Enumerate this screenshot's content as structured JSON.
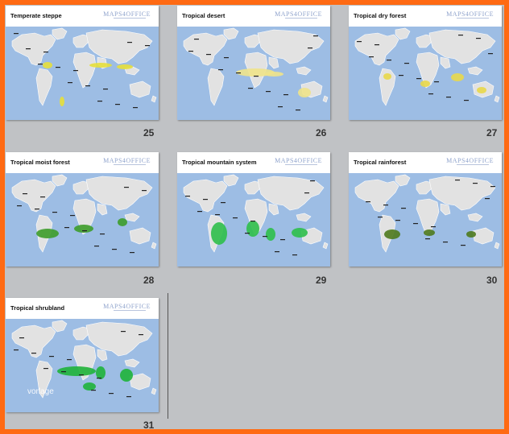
{
  "slides": [
    {
      "title": "Temperate steppe",
      "number": "25",
      "logo": "MAPS4OFFICE",
      "highlight": "#e7df3a"
    },
    {
      "title": "Tropical desert",
      "number": "26",
      "logo": "MAPS4OFFICE",
      "highlight": "#f0e38a"
    },
    {
      "title": "Tropical dry forest",
      "number": "27",
      "logo": "MAPS4OFFICE",
      "highlight": "#e9d84a"
    },
    {
      "title": "Tropical moist forest",
      "number": "28",
      "logo": "MAPS4OFFICE",
      "highlight": "#3d9c2a"
    },
    {
      "title": "Tropical mountain system",
      "number": "29",
      "logo": "MAPS4OFFICE",
      "highlight": "#2fbf4a"
    },
    {
      "title": "Tropical rainforest",
      "number": "30",
      "logo": "MAPS4OFFICE",
      "highlight": "#4f7a1d"
    },
    {
      "title": "Tropical shrubland",
      "number": "31",
      "logo": "MAPS4OFFICE",
      "highlight": "#1fb33a"
    }
  ],
  "watermark": "vorlage",
  "colors": {
    "border": "#ff6a13",
    "background": "#c0c2c5",
    "ocean": "#9dbde4",
    "land": "#e2e2e2"
  }
}
